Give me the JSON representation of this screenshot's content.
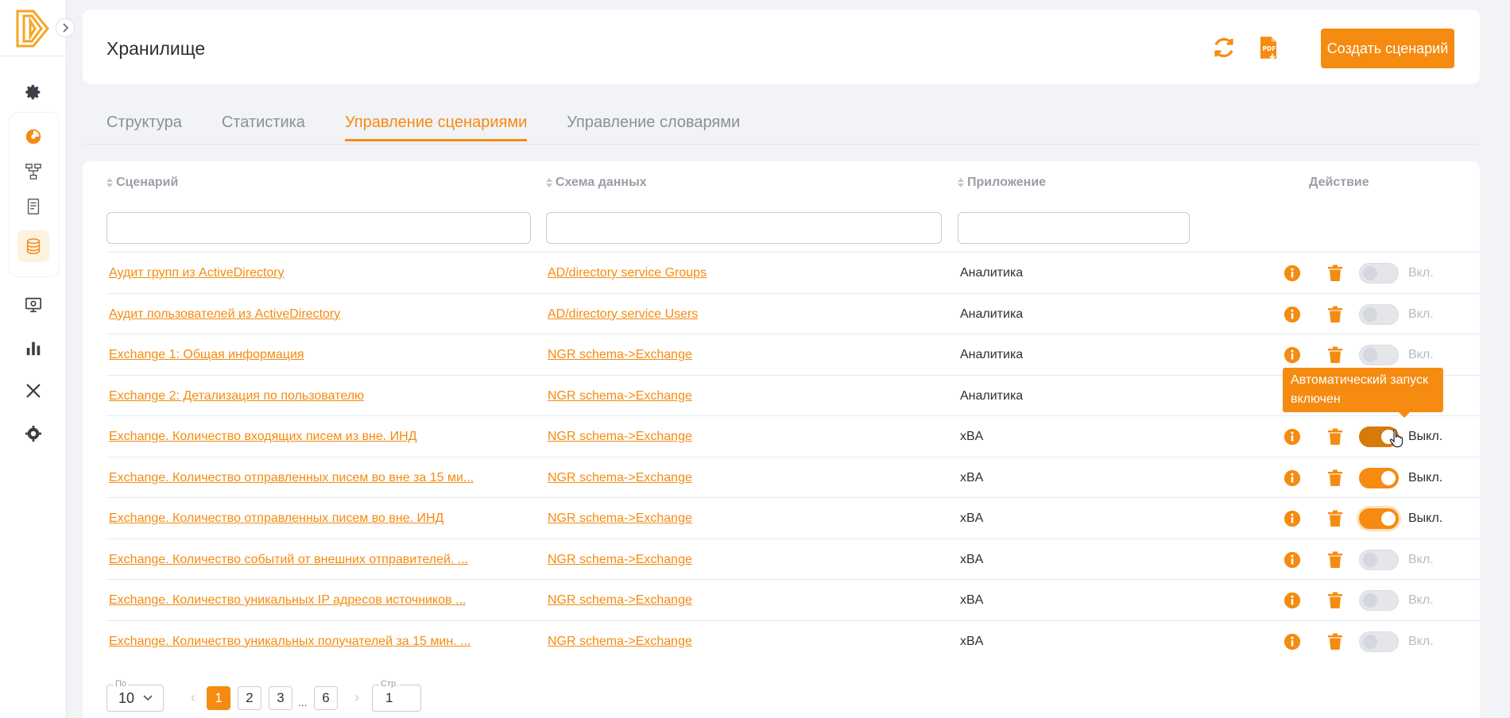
{
  "header": {
    "title": "Хранилище",
    "create_label": "Создать сценарий"
  },
  "tabs": [
    {
      "label": "Структура"
    },
    {
      "label": "Статистика"
    },
    {
      "label": "Управление сценариями",
      "active": true
    },
    {
      "label": "Управление словарями"
    }
  ],
  "table": {
    "columns": {
      "scenario": "Сценарий",
      "schema": "Схема данных",
      "app": "Приложение",
      "action": "Действие"
    },
    "rows": [
      {
        "name": "Аудит групп из ActiveDirectory",
        "schema": "AD/directory service Groups",
        "app": "Аналитика",
        "toggle_label": "Вкл.",
        "on": false
      },
      {
        "name": "Аудит пользователей из ActiveDirectory",
        "schema": "AD/directory service Users",
        "app": "Аналитика",
        "toggle_label": "Вкл.",
        "on": false
      },
      {
        "name": "Exchange 1: Общая информация",
        "schema": "NGR schema->Exchange",
        "app": "Аналитика",
        "toggle_label": "Вкл.",
        "on": false
      },
      {
        "name": "Exchange 2: Детализация по пользователю",
        "schema": "NGR schema->Exchange",
        "app": "Аналитика",
        "toggle_label": "",
        "on": false
      },
      {
        "name": "Exchange. Количество входящих писем из вне. ИНД",
        "schema": "NGR schema->Exchange",
        "app": "xBA",
        "toggle_label": "Выкл.",
        "on": true
      },
      {
        "name": "Exchange. Количество отправленных писем во вне за 15 ми...",
        "schema": "NGR schema->Exchange",
        "app": "xBA",
        "toggle_label": "Выкл.",
        "on": true
      },
      {
        "name": "Exchange. Количество отправленных писем во вне. ИНД",
        "schema": "NGR schema->Exchange",
        "app": "xBA",
        "toggle_label": "Выкл.",
        "on": true
      },
      {
        "name": "Exchange. Количество событий от внешних отправителей. ...",
        "schema": "NGR schema->Exchange",
        "app": "xBA",
        "toggle_label": "Вкл.",
        "on": false
      },
      {
        "name": "Exchange. Количество уникальных IP адресов источников ...",
        "schema": "NGR schema->Exchange",
        "app": "xBA",
        "toggle_label": "Вкл.",
        "on": false
      },
      {
        "name": "Exchange. Количество уникальных получателей за 15 мин. ...",
        "schema": "NGR schema->Exchange",
        "app": "xBA",
        "toggle_label": "Вкл.",
        "on": false
      }
    ]
  },
  "tooltip": {
    "text": "Автоматический запуск включен"
  },
  "pagination": {
    "per_page_label": "По",
    "per_page_value": "10",
    "pages": [
      "1",
      "2",
      "3",
      "6"
    ],
    "current_page": "1",
    "ellipsis": "...",
    "page_input_label": "Стр.",
    "page_input_value": "1"
  },
  "colors": {
    "accent": "#f58b10",
    "background": "#f2f3f7"
  },
  "icons": {
    "sidebar": [
      "logo-icon",
      "settings-icon",
      "dashboard-icon",
      "structure-icon",
      "report-icon",
      "database-icon",
      "monitor-icon",
      "chart-icon",
      "tools-icon",
      "gear-cluster-icon"
    ],
    "header": [
      "refresh-icon",
      "pdf-icon"
    ],
    "row_actions": [
      "info-icon",
      "trash-icon"
    ]
  }
}
